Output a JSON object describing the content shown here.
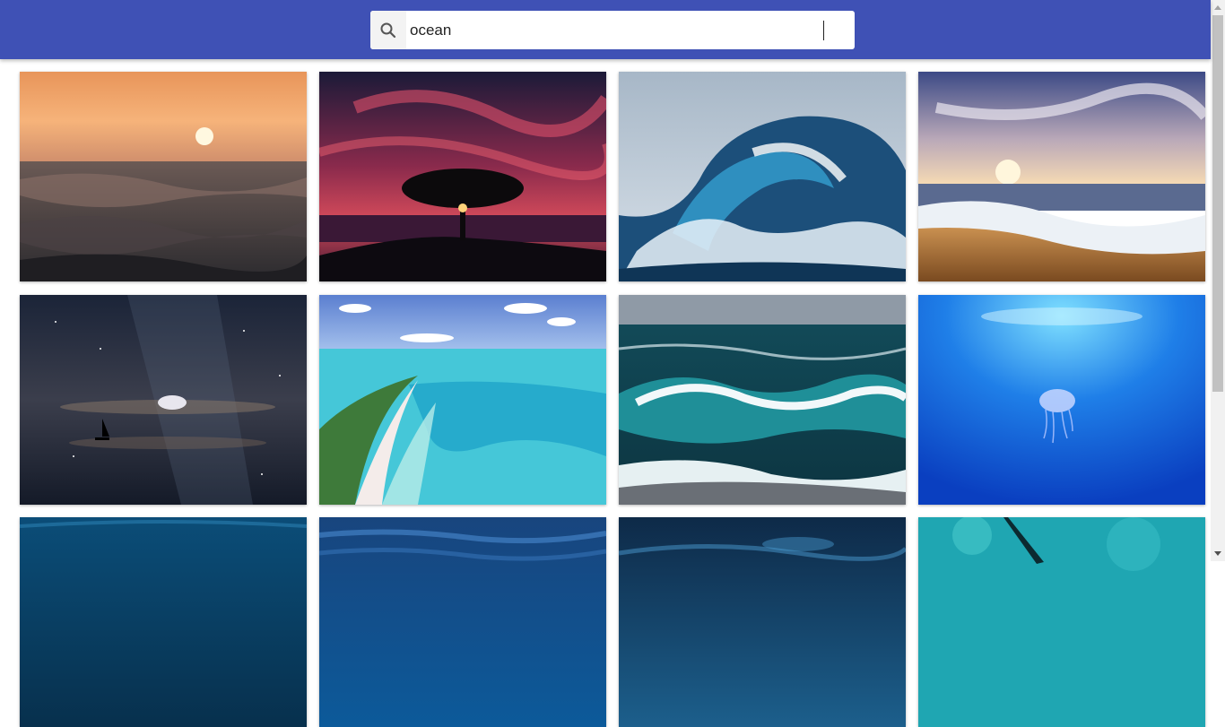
{
  "search": {
    "value": "ocean",
    "icon": "search-icon"
  },
  "colors": {
    "appbar": "#3f51b5"
  },
  "photos": [
    {
      "id": "sunset-waves"
    },
    {
      "id": "tree-red-sky"
    },
    {
      "id": "curling-wave"
    },
    {
      "id": "beach-sunrise"
    },
    {
      "id": "night-sailboat"
    },
    {
      "id": "tropical-lagoon"
    },
    {
      "id": "green-waves"
    },
    {
      "id": "jellyfish-blue"
    },
    {
      "id": "deep-blue-1"
    },
    {
      "id": "deep-blue-2"
    },
    {
      "id": "stormy-sea"
    },
    {
      "id": "turquoise-reef"
    }
  ]
}
